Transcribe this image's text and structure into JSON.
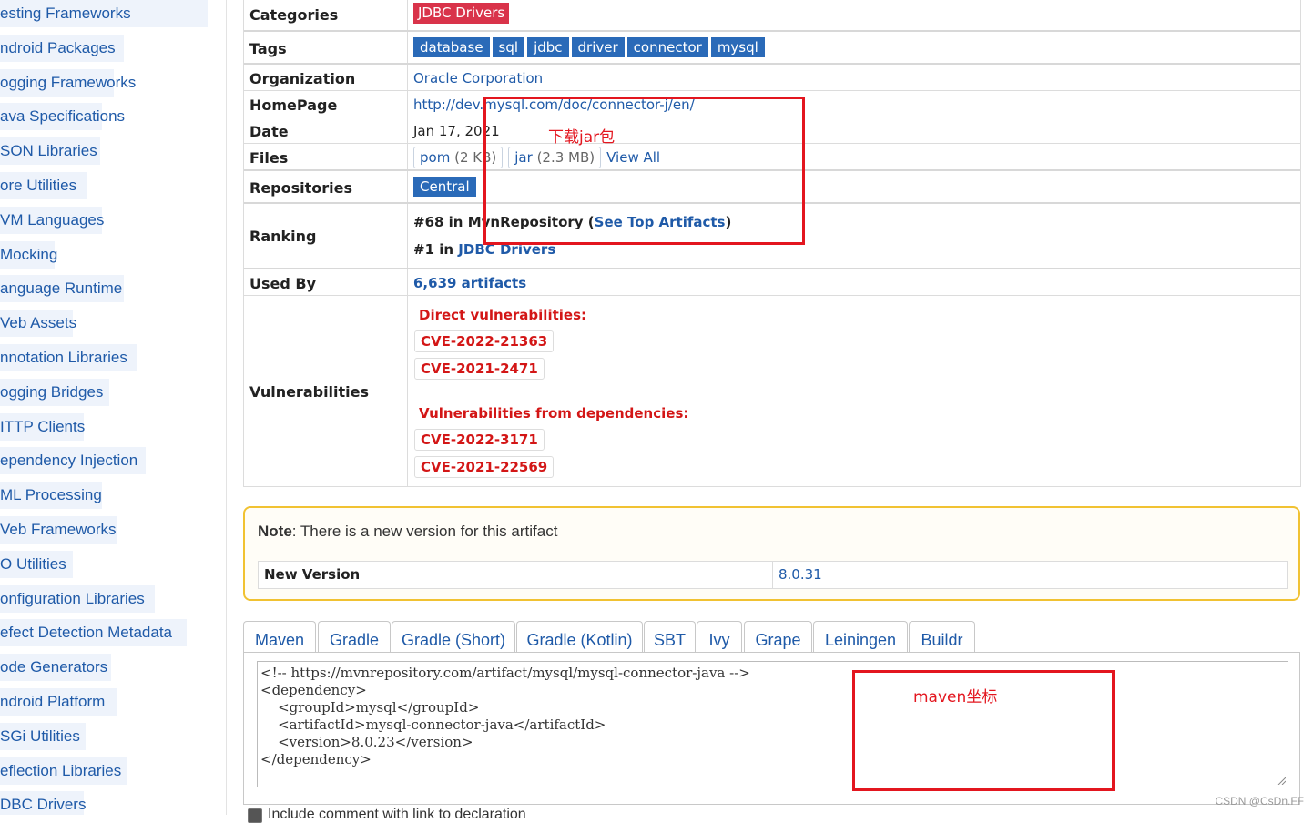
{
  "sidebar": {
    "items": [
      {
        "label": "esting Frameworks"
      },
      {
        "label": "ndroid Packages"
      },
      {
        "label": "ogging Frameworks"
      },
      {
        "label": "ava Specifications"
      },
      {
        "label": "SON Libraries"
      },
      {
        "label": "ore Utilities"
      },
      {
        "label": "VM Languages"
      },
      {
        "label": "Mocking"
      },
      {
        "label": "anguage Runtime"
      },
      {
        "label": "Veb Assets"
      },
      {
        "label": "nnotation Libraries"
      },
      {
        "label": "ogging Bridges"
      },
      {
        "label": "ITTP Clients"
      },
      {
        "label": "ependency Injection"
      },
      {
        "label": "ML Processing"
      },
      {
        "label": "Veb Frameworks"
      },
      {
        "label": "O Utilities"
      },
      {
        "label": "onfiguration Libraries"
      },
      {
        "label": "efect Detection Metadata"
      },
      {
        "label": "ode Generators"
      },
      {
        "label": "ndroid Platform"
      },
      {
        "label": "SGi Utilities"
      },
      {
        "label": "eflection Libraries"
      },
      {
        "label": "DBC Drivers"
      }
    ]
  },
  "info": {
    "categories": {
      "label": "Categories",
      "value": "JDBC Drivers"
    },
    "tags": {
      "label": "Tags",
      "values": [
        "database",
        "sql",
        "jdbc",
        "driver",
        "connector",
        "mysql"
      ]
    },
    "organization": {
      "label": "Organization",
      "value": "Oracle Corporation"
    },
    "homepage": {
      "label": "HomePage",
      "value": "http://dev.mysql.com/doc/connector-j/en/"
    },
    "date": {
      "label": "Date",
      "value": "Jan 17, 2021"
    },
    "files": {
      "label": "Files",
      "pom": {
        "name": "pom",
        "size": "(2 KB)"
      },
      "jar": {
        "name": "jar",
        "size": "(2.3 MB)"
      },
      "view_all": "View All"
    },
    "repositories": {
      "label": "Repositories",
      "value": "Central"
    },
    "ranking": {
      "label": "Ranking",
      "line1_prefix": "#68 in MvnRepository (",
      "line1_link": "See Top Artifacts",
      "line1_suffix": ")",
      "line2_prefix": "#1 in ",
      "line2_link": "JDBC Drivers"
    },
    "used_by": {
      "label": "Used By",
      "value": "6,639 artifacts"
    },
    "vulnerabilities": {
      "label": "Vulnerabilities",
      "direct_heading": "Direct vulnerabilities:",
      "direct": [
        "CVE-2022-21363",
        "CVE-2021-2471"
      ],
      "deps_heading": "Vulnerabilities from dependencies:",
      "deps": [
        "CVE-2022-3171",
        "CVE-2021-22569"
      ]
    }
  },
  "note": {
    "bold": "Note",
    "text": ": There is a new version for this artifact",
    "new_version_label": "New Version",
    "new_version_value": "8.0.31"
  },
  "tabs": [
    "Maven",
    "Gradle",
    "Gradle (Short)",
    "Gradle (Kotlin)",
    "SBT",
    "Ivy",
    "Grape",
    "Leiningen",
    "Buildr"
  ],
  "active_tab": "Maven",
  "snippet": "<!-- https://mvnrepository.com/artifact/mysql/mysql-connector-java -->\n<dependency>\n    <groupId>mysql</groupId>\n    <artifactId>mysql-connector-java</artifactId>\n    <version>8.0.23</version>\n</dependency>",
  "checkbox_label": "Include comment with link to declaration",
  "annotations": {
    "download_jar": "下载jar包",
    "maven_coords": "maven坐标"
  },
  "watermark": "CSDN @CsDn.FF",
  "colors": {
    "link": "#1f5aa8",
    "category_badge": "#d9334a",
    "tag": "#2a6ab8",
    "vuln": "#d31616",
    "annotation": "#e3161f",
    "note_border": "#f1c232"
  }
}
